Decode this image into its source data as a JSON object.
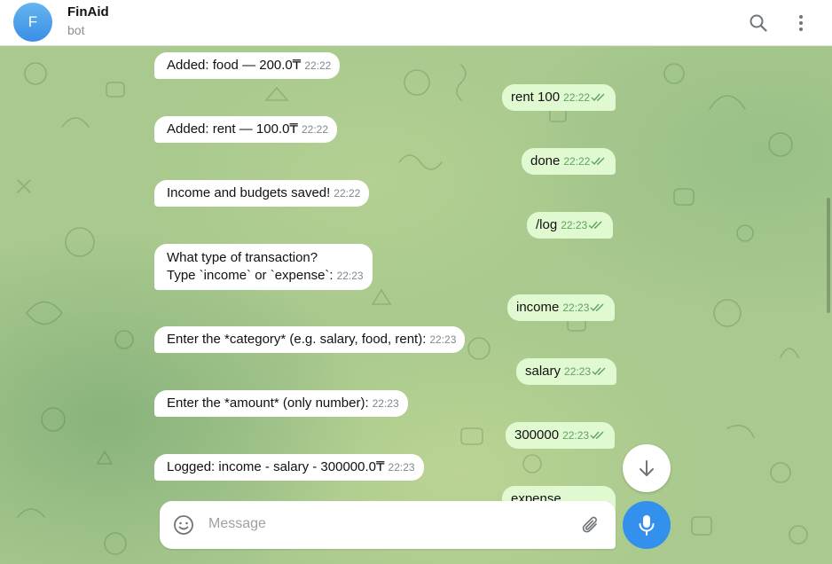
{
  "header": {
    "avatar_letter": "F",
    "title": "FinAid",
    "subtitle": "bot",
    "icons": [
      "search-icon",
      "more-vertical-icon"
    ]
  },
  "messages": [
    {
      "dir": "in",
      "text": "Added: food — 200.0₸",
      "time": "22:22"
    },
    {
      "dir": "out",
      "text": "rent 100",
      "time": "22:22",
      "read": true
    },
    {
      "dir": "in",
      "text": "Added: rent — 100.0₸",
      "time": "22:22"
    },
    {
      "dir": "out",
      "text": "done",
      "time": "22:22",
      "read": true
    },
    {
      "dir": "in",
      "text": "Income and budgets saved!",
      "time": "22:22"
    },
    {
      "dir": "out",
      "text": "/log",
      "time": "22:23",
      "read": true,
      "is_command": true
    },
    {
      "dir": "in",
      "line1": "What type of transaction?",
      "line2": "Type `income` or `expense`:",
      "time": "22:23"
    },
    {
      "dir": "out",
      "text": "income",
      "time": "22:23",
      "read": true
    },
    {
      "dir": "in",
      "text": "Enter the *category* (e.g. salary, food, rent):",
      "time": "22:23"
    },
    {
      "dir": "out",
      "text": "salary",
      "time": "22:23",
      "read": true
    },
    {
      "dir": "in",
      "text": "Enter the *amount* (only number):",
      "time": "22:23"
    },
    {
      "dir": "out",
      "text": "300000",
      "time": "22:23",
      "read": true
    },
    {
      "dir": "in",
      "text": "Logged: income - salary - 300000.0₸",
      "time": "22:23"
    },
    {
      "dir": "out",
      "text": "expense",
      "time": "",
      "partial": true
    }
  ],
  "composer": {
    "placeholder": "Message",
    "icons": [
      "emoji-icon",
      "paperclip-icon",
      "microphone-icon",
      "arrow-down-icon"
    ]
  },
  "colors": {
    "accent": "#3390ec",
    "outgoing_bubble": "#e0f9d0",
    "incoming_bubble": "#ffffff",
    "read_ticks": "#5fa35f",
    "command_link": "#3a93d4"
  }
}
